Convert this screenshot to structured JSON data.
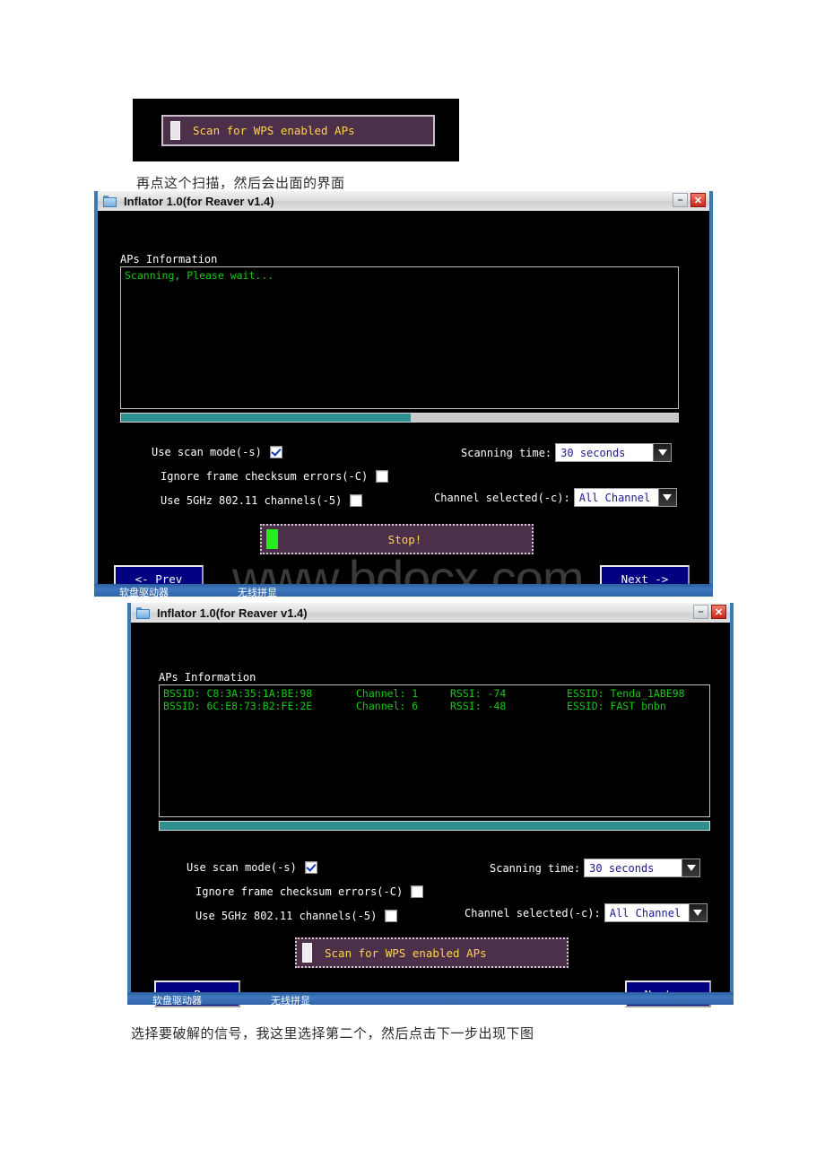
{
  "page": {
    "watermark": "www.bdocx.com"
  },
  "top_button": {
    "label": "Scan for WPS enabled APs",
    "led": "led-indicator"
  },
  "captions": {
    "first": "再点这个扫描，然后会出面的界面",
    "second": "选择要破解的信号，我这里选择第二个，然后点击下一步出现下图"
  },
  "window1": {
    "title": "Inflator 1.0(for Reaver v1.4)",
    "icon": "folder-icon",
    "minimize_label": "–",
    "close_label": "✕",
    "aps_section_label": "APs Information",
    "aps_status": "Scanning, Please wait...",
    "progress_percent": 52,
    "options": [
      {
        "label": "Use scan mode(-s)",
        "checked": true
      },
      {
        "label": "Ignore frame checksum errors(-C)",
        "checked": false
      },
      {
        "label": "Use 5GHz 802.11 channels(-5)",
        "checked": false
      }
    ],
    "dropdowns": [
      {
        "label": "Scanning time:",
        "value": "30 seconds"
      },
      {
        "label": "Channel selected(-c):",
        "value": "All Channel"
      }
    ],
    "action_button": {
      "label": "Stop!",
      "led": "led-green-active"
    },
    "prev_label": "<- Prev",
    "next_label": "Next ->",
    "taskbar": [
      {
        "label": "软盘驱动器"
      },
      {
        "label": "无线拼显"
      }
    ]
  },
  "window2": {
    "title": "Inflator 1.0(for Reaver v1.4)",
    "icon": "folder-icon",
    "minimize_label": "–",
    "close_label": "✕",
    "aps_section_label": "APs Information",
    "aps_rows": [
      {
        "bssid": "BSSID: C8:3A:35:1A:BE:98",
        "channel": "Channel: 1",
        "rssi": "RSSI: -74",
        "essid": "ESSID: Tenda_1ABE98"
      },
      {
        "bssid": "BSSID: 6C:E8:73:B2:FE:2E",
        "channel": "Channel: 6",
        "rssi": "RSSI: -48",
        "essid": "ESSID: FAST bnbn"
      }
    ],
    "progress_percent": 100,
    "options": [
      {
        "label": "Use scan mode(-s)",
        "checked": true
      },
      {
        "label": "Ignore frame checksum errors(-C)",
        "checked": false
      },
      {
        "label": "Use 5GHz 802.11 channels(-5)",
        "checked": false
      }
    ],
    "dropdowns": [
      {
        "label": "Scanning time:",
        "value": "30 seconds"
      },
      {
        "label": "Channel selected(-c):",
        "value": "All Channel"
      }
    ],
    "action_button": {
      "label": "Scan for WPS enabled APs",
      "led": "led-indicator"
    },
    "prev_label": "<- Prev",
    "next_label": "Next ->",
    "taskbar": [
      {
        "label": "软盘驱动器"
      },
      {
        "label": "无线拼显"
      }
    ]
  }
}
